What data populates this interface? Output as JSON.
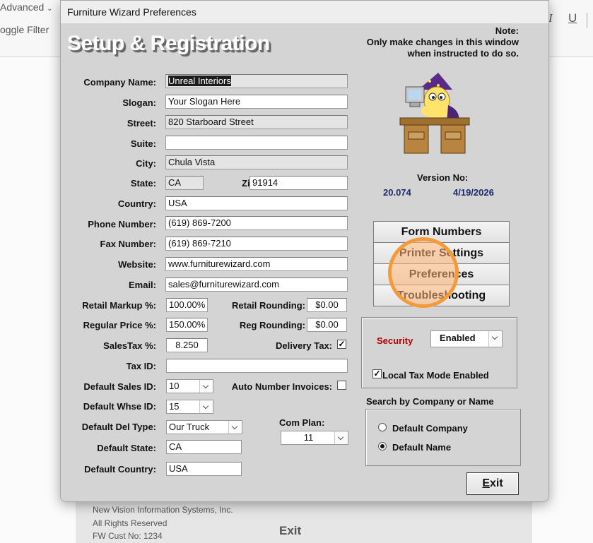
{
  "background": {
    "advanced_label": "Advanced",
    "toggle_filter_label": "oggle Filter",
    "italic_label": "I",
    "underline_label": "U",
    "footer_company": "New Vision Information Systems, Inc.",
    "footer_rights": "All Rights Reserved",
    "footer_cust": "FW Cust No: 1234",
    "exit_label": "Exit"
  },
  "window": {
    "title": "Furniture Wizard Preferences",
    "heading": "Setup & Registration",
    "note_lines": [
      "Note:",
      "Only make changes in this window",
      "when instructed to do so."
    ]
  },
  "version": {
    "label": "Version No:",
    "number": "20.074",
    "date": "4/19/2026"
  },
  "form": {
    "company_name": {
      "label": "Company Name:",
      "value": "Unreal Interiors"
    },
    "slogan": {
      "label": "Slogan:",
      "value": "Your Slogan Here"
    },
    "street": {
      "label": "Street:",
      "value": "820 Starboard Street"
    },
    "suite": {
      "label": "Suite:",
      "value": ""
    },
    "city": {
      "label": "City:",
      "value": "Chula Vista"
    },
    "state": {
      "label": "State:",
      "value": "CA"
    },
    "zip": {
      "label": "Zip:",
      "value": "91914"
    },
    "country": {
      "label": "Country:",
      "value": "USA"
    },
    "phone": {
      "label": "Phone Number:",
      "value": "(619) 869-7200"
    },
    "fax": {
      "label": "Fax Number:",
      "value": "(619) 869-7210"
    },
    "website": {
      "label": "Website:",
      "value": "www.furniturewizard.com"
    },
    "email": {
      "label": "Email:",
      "value": "sales@furniturewizard.com"
    },
    "retail_markup": {
      "label": "Retail Markup %:",
      "value": "100.00%"
    },
    "retail_rounding": {
      "label": "Retail Rounding:",
      "value": "$0.00"
    },
    "regular_price": {
      "label": "Regular  Price %:",
      "value": "150.00%"
    },
    "reg_rounding": {
      "label": "Reg Rounding:",
      "value": "$0.00"
    },
    "sales_tax": {
      "label": "SalesTax %:",
      "value": "8.250"
    },
    "delivery_tax": {
      "label": "Delivery Tax:",
      "checked": true
    },
    "tax_id": {
      "label": "Tax ID:",
      "value": ""
    },
    "default_sales_id": {
      "label": "Default Sales ID:",
      "value": "10"
    },
    "auto_number": {
      "label": "Auto Number Invoices:",
      "checked": false
    },
    "default_whse_id": {
      "label": "Default Whse ID:",
      "value": "15"
    },
    "default_del_type": {
      "label": "Default Del Type:",
      "value": "Our Truck"
    },
    "com_plan": {
      "label": "Com Plan:",
      "value": "11"
    },
    "default_state": {
      "label": "Default State:",
      "value": "CA"
    },
    "default_country": {
      "label": "Default Country:",
      "value": "USA"
    }
  },
  "nav_buttons": [
    "Form Numbers",
    "Printer Settings",
    "Preferences",
    "Troubleshooting"
  ],
  "security": {
    "label": "Security",
    "value": "Enabled",
    "local_tax_label": "Local Tax Mode Enabled",
    "local_tax_checked": true
  },
  "search": {
    "title": "Search by Company or Name",
    "options": [
      "Default Company",
      "Default Name"
    ],
    "selected": "Default Name"
  },
  "exit_button": {
    "label_first": "E",
    "label_rest": "xit"
  },
  "colors": {
    "dialog_bg": "#d4d4d4",
    "security_red": "#b00000",
    "version_blue": "#1b2a6b",
    "highlight_orange": "#f39a3a"
  }
}
